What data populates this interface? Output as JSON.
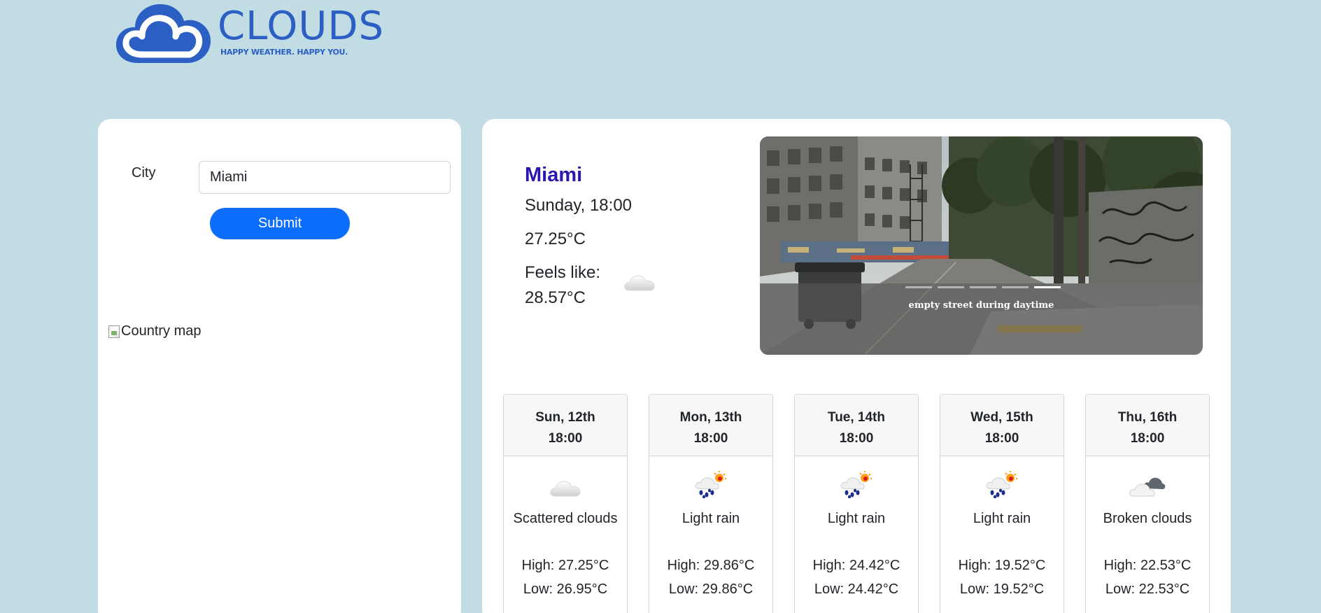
{
  "brand": {
    "title": "CLOUDS",
    "tagline": "HAPPY WEATHER. HAPPY YOU.",
    "color": "#2b5fc4",
    "logo_icon": "cloud-logo-icon"
  },
  "search": {
    "city_label": "City",
    "city_value": "Miami",
    "submit_label": "Submit"
  },
  "map": {
    "alt": "Country map"
  },
  "current": {
    "city": "Miami",
    "datetime": "Sunday, 18:00",
    "temperature": "27.25°C",
    "feels_like_label": "Feels like:",
    "feels_like_value": "28.57°C",
    "icon": "scattered-clouds-icon"
  },
  "carousel": {
    "caption": "empty street during daytime",
    "slide_count": 5,
    "active_slide": 5
  },
  "forecast": [
    {
      "day": "Sun, 12th",
      "time": "18:00",
      "icon": "scattered-clouds-icon",
      "description": "Scattered clouds",
      "high": "High: 27.25°C",
      "low": "Low: 26.95°C"
    },
    {
      "day": "Mon, 13th",
      "time": "18:00",
      "icon": "light-rain-icon",
      "description": "Light rain",
      "high": "High: 29.86°C",
      "low": "Low: 29.86°C"
    },
    {
      "day": "Tue, 14th",
      "time": "18:00",
      "icon": "light-rain-icon",
      "description": "Light rain",
      "high": "High: 24.42°C",
      "low": "Low: 24.42°C"
    },
    {
      "day": "Wed, 15th",
      "time": "18:00",
      "icon": "light-rain-icon",
      "description": "Light rain",
      "high": "High: 19.52°C",
      "low": "Low: 19.52°C"
    },
    {
      "day": "Thu, 16th",
      "time": "18:00",
      "icon": "broken-clouds-icon",
      "description": "Broken clouds",
      "high": "High: 22.53°C",
      "low": "Low: 22.53°C"
    }
  ],
  "colors": {
    "background": "#c1dce3",
    "primary_button": "#0d6efd",
    "city_name": "#2a17b1"
  }
}
